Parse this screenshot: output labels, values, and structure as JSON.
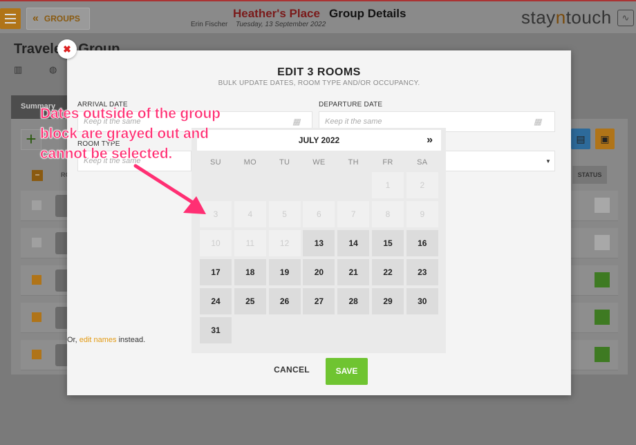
{
  "app": {
    "groups_button": "GROUPS",
    "hotel_name": "Heather's Place",
    "page_title": "Group Details",
    "user_name": "Erin Fischer",
    "date": "Tuesday, 13 September 2022",
    "brand_prefix": "stay",
    "brand_mid": "n",
    "brand_suffix": "touch"
  },
  "group": {
    "title": "Travelers Group",
    "tabs": [
      {
        "label": "Summary"
      }
    ],
    "columns": {
      "room_short": "RO",
      "status": "STATUS"
    }
  },
  "modal": {
    "title": "EDIT 3 ROOMS",
    "subtitle": "BULK UPDATE DATES, ROOM TYPE AND/OR OCCUPANCY.",
    "arrival_label": "ARRIVAL DATE",
    "arrival_placeholder": "Keep it the same",
    "departure_label": "DEPARTURE DATE",
    "departure_placeholder": "Keep it the same",
    "room_type_label": "ROOM TYPE",
    "room_type_placeholder": "Keep it the same",
    "or_prefix": "Or,",
    "edit_names_link": "edit names",
    "or_suffix": "instead.",
    "cancel_label": "CANCEL",
    "save_label": "SAVE"
  },
  "calendar": {
    "month_label": "JULY 2022",
    "next_icon": "double-chevron-right-icon",
    "weekdays": [
      "SU",
      "MO",
      "TU",
      "WE",
      "TH",
      "FR",
      "SA"
    ],
    "first_weekday_index": 5,
    "days_in_month": 31,
    "first_selectable_day": 13,
    "disabled_color": "#cccccc",
    "enabled_color": "#222222"
  },
  "annotation": {
    "text": "Dates outside of the group block are grayed out and cannot be selected.",
    "color": "#ff2f73"
  },
  "colors": {
    "accent": "#e39a12",
    "save": "#6fc431",
    "close": "#dd2222"
  }
}
